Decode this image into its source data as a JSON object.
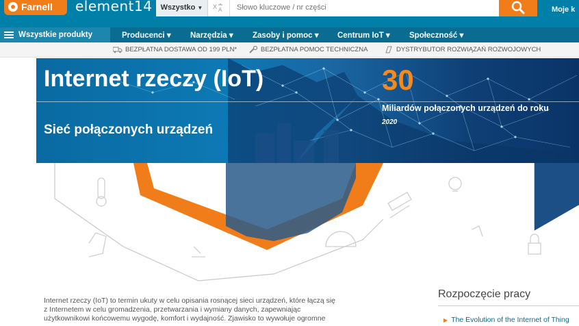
{
  "header": {
    "farnell_logo": "Farnell",
    "element14_logo": "element14",
    "search_category": "Wszystko",
    "search_placeholder": "Słowo kluczowe / nr części",
    "account_top": "",
    "account_label": "Moje k"
  },
  "nav": {
    "all_products": "Wszystkie produkty",
    "items": [
      "Producenci",
      "Narzędzia",
      "Zasoby i pomoc",
      "Centrum IoT",
      "Społeczność"
    ]
  },
  "promo": {
    "items": [
      "BEZPŁATNA DOSTAWA OD 199 PLN*",
      "BEZPŁATNA POMOC TECHNICZNA",
      "DYSTRYBUTOR ROZWIĄZAŃ ROZWOJOWYCH"
    ]
  },
  "hero": {
    "title": "Internet rzeczy (IoT)",
    "subtitle": "Sieć połączonych urządzeń",
    "stat_number": "30",
    "stat_label": "Miliardów połączonych urządzeń do roku",
    "stat_year": "2020"
  },
  "intro": {
    "line1": "Internet rzeczy (IoT) to termin ukuty w celu opisania rosnącej sieci urządzeń, które łączą się",
    "line2": "z Internetem w celu gromadzenia, przetwarzania i wymiany danych, zapewniając",
    "line3": "użytkownikowi końcowemu wygodę, komfort i wydajność. Zjawisko to wywołuje ogromne"
  },
  "sidebar": {
    "title": "Rozpoczęcie pracy",
    "link1": "The Evolution of the Internet of Thing"
  },
  "colors": {
    "brand_blue": "#007fa8",
    "nav_blue": "#0a6c91",
    "accent_orange": "#f07d1a"
  }
}
